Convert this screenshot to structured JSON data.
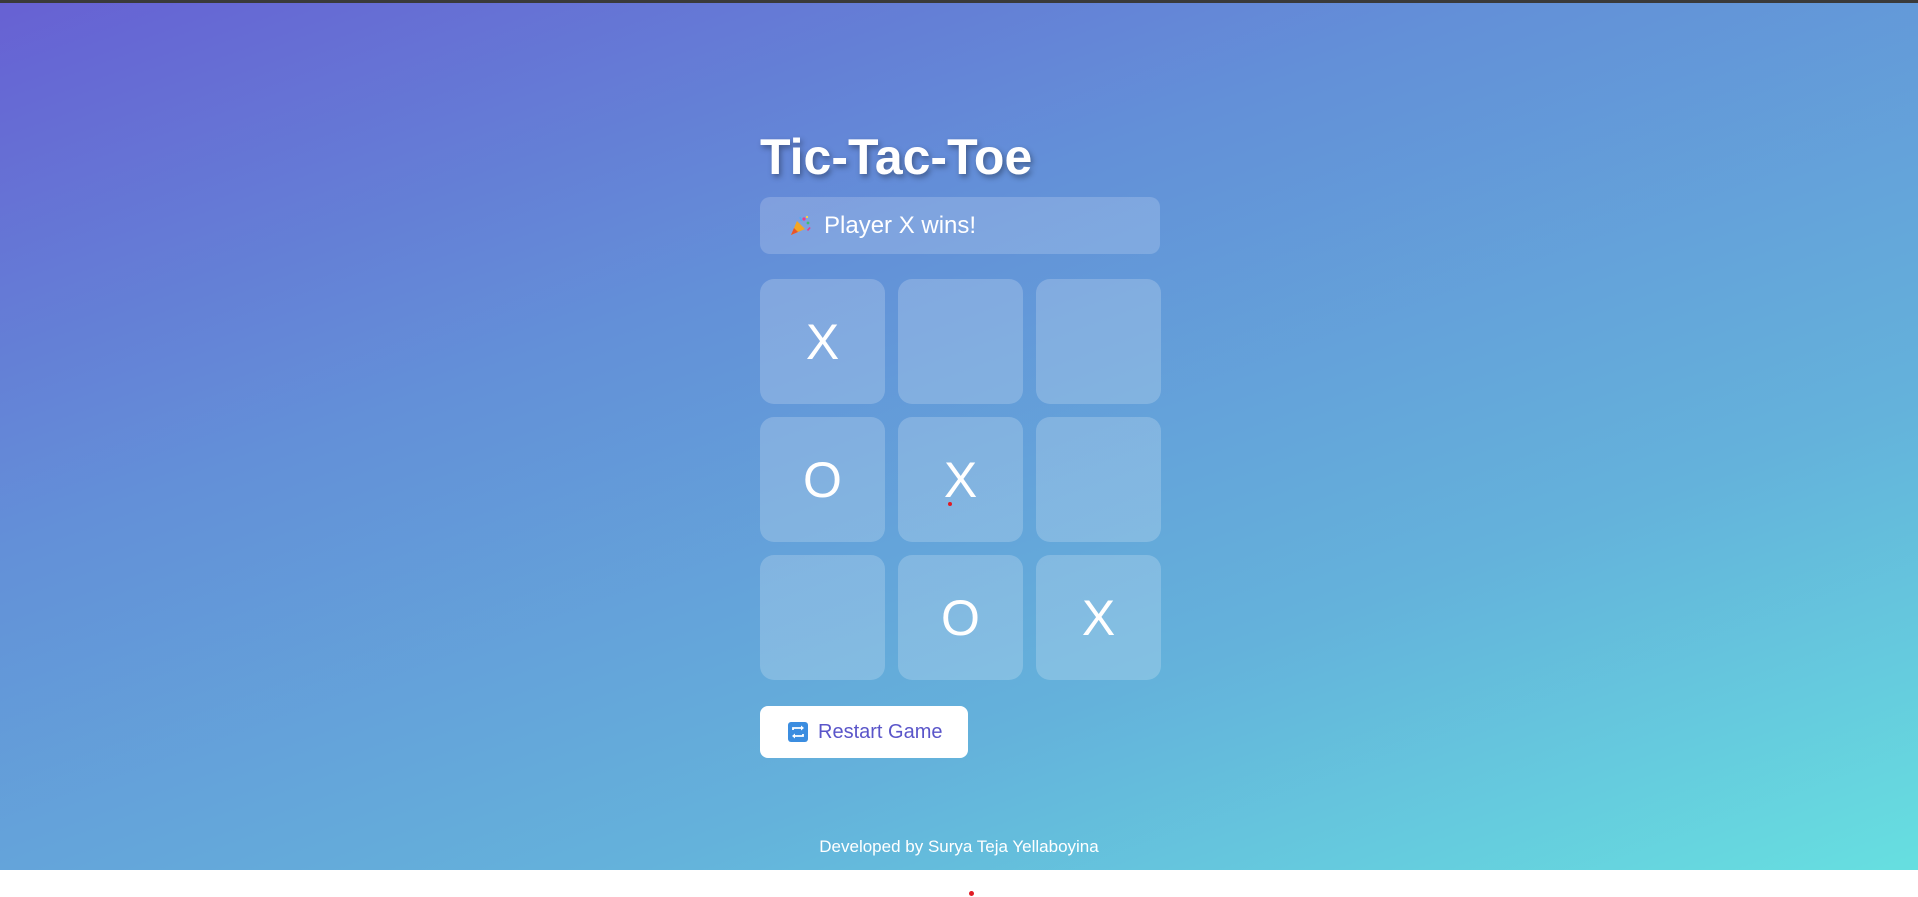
{
  "game": {
    "title": "Tic-Tac-Toe",
    "status_text": "Player X wins!",
    "status_icon": "party-popper-icon",
    "board": [
      "X",
      "",
      "",
      "O",
      "X",
      "",
      "",
      "O",
      "X"
    ],
    "restart_label": "Restart Game",
    "restart_icon": "repeat-icon"
  },
  "footer": {
    "credit": "Developed by Surya Teja Yellaboyina"
  },
  "colors": {
    "gradient_start": "#6761d3",
    "gradient_end": "#66dfe0",
    "button_text": "#5a55c9",
    "cursor_marker": "#e01b24"
  }
}
